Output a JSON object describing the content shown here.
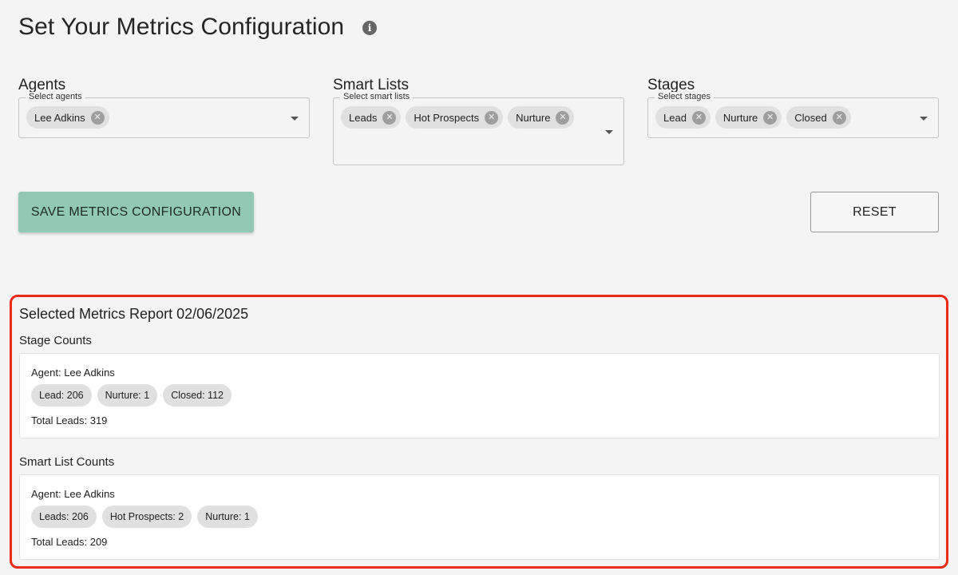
{
  "page": {
    "title": "Set Your Metrics Configuration",
    "info_icon": "info-icon"
  },
  "filters": {
    "agents": {
      "heading": "Agents",
      "legend": "Select agents",
      "selected": [
        "Lee Adkins"
      ]
    },
    "smart_lists": {
      "heading": "Smart Lists",
      "legend": "Select smart lists",
      "selected": [
        "Leads",
        "Hot Prospects",
        "Nurture"
      ]
    },
    "stages": {
      "heading": "Stages",
      "legend": "Select stages",
      "selected": [
        "Lead",
        "Nurture",
        "Closed"
      ]
    },
    "chip_delete_icon": "close-circle-icon",
    "dropdown_icon": "caret-down-icon"
  },
  "actions": {
    "save_label": "SAVE METRICS CONFIGURATION",
    "reset_label": "RESET",
    "save_color": "#92c9b4"
  },
  "report": {
    "title": "Selected Metrics Report 02/06/2025",
    "highlight_color": "#ec2a1a",
    "stage_counts": {
      "heading": "Stage Counts",
      "agent": "Agent: Lee Adkins",
      "items": [
        "Lead: 206",
        "Nurture: 1",
        "Closed: 112"
      ],
      "total": "Total Leads: 319"
    },
    "smart_list_counts": {
      "heading": "Smart List Counts",
      "agent": "Agent: Lee Adkins",
      "items": [
        "Leads: 206",
        "Hot Prospects: 2",
        "Nurture: 1"
      ],
      "total": "Total Leads: 209"
    }
  }
}
